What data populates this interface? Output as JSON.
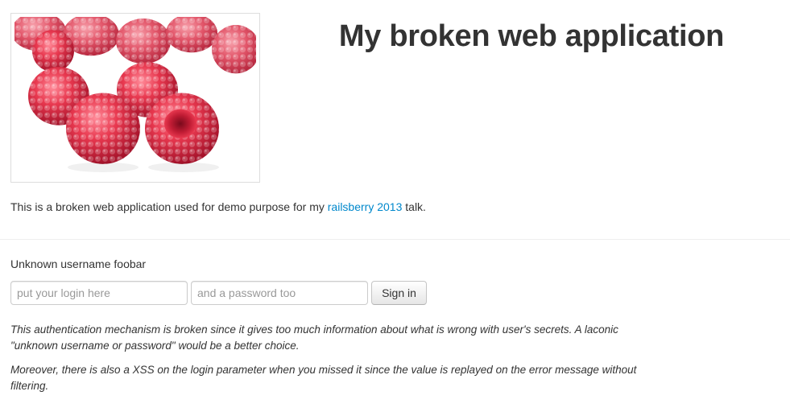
{
  "header": {
    "title": "My broken web application",
    "image_name": "raspberries"
  },
  "intro": {
    "text_before": "This is a broken web application used for demo purpose for my ",
    "link_text": "railsberry 2013",
    "text_after": " talk."
  },
  "login": {
    "error_message": "Unknown username foobar",
    "login_placeholder": "put your login here",
    "password_placeholder": "and a password too",
    "submit_label": "Sign in"
  },
  "notes": [
    "This authentication mechanism is broken since it gives too much information about what is wrong with user's secrets. A laconic \"unknown username or password\" would be a better choice.",
    "Moreover, there is also a XSS on the login parameter when you missed it since the value is replayed on the error message without filtering."
  ],
  "colors": {
    "link": "#0088cc",
    "text": "#333333",
    "berry": "#e0344a"
  }
}
